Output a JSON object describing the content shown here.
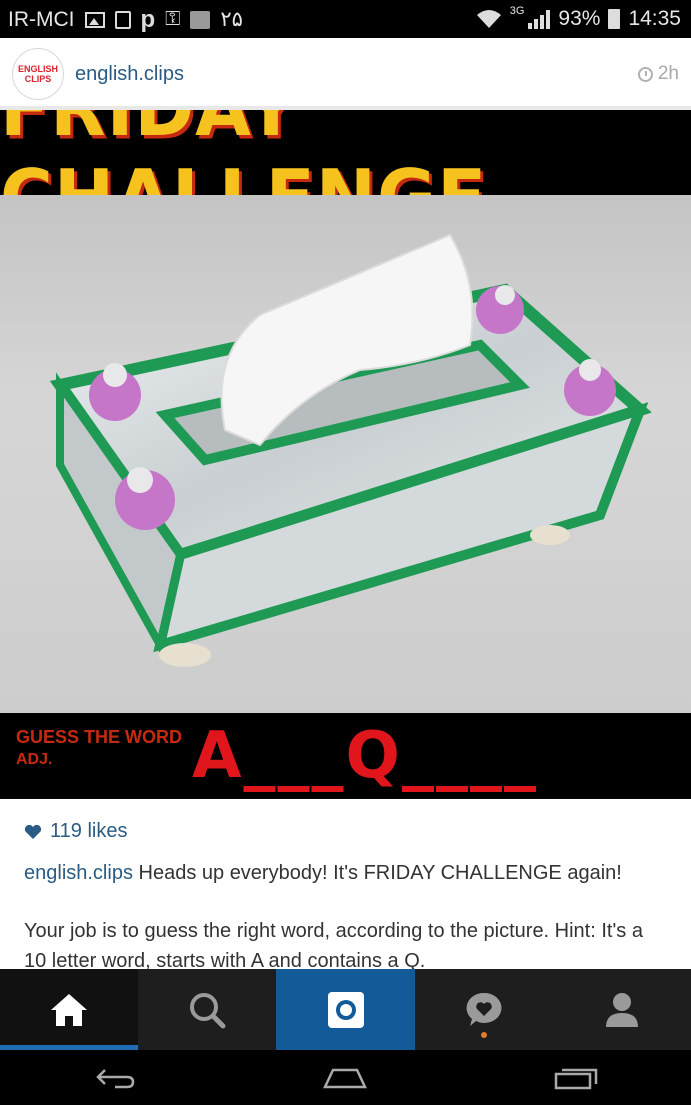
{
  "status_bar": {
    "carrier": "IR-MCI",
    "notification_number": "۲۵",
    "network": "3G",
    "battery": "93%",
    "time": "14:35"
  },
  "post": {
    "username": "english.clips",
    "avatar_text_line1": "ENGLISH",
    "avatar_text_line2": "CLIPS",
    "time_ago": "2h",
    "image": {
      "banner_title": "FRIDAY CHALLENGE",
      "hint_line1": "GUESS THE WORD",
      "hint_line2": "ADJ.",
      "word_pattern": "A___Q____"
    },
    "likes": "119 likes",
    "caption_user": "english.clips",
    "caption_text": "Heads up everybody! It's FRIDAY CHALLENGE again!",
    "caption_paragraph2": "Your job is to guess the right word, according to the picture. Hint: It's a 10 letter word, starts with A and contains a Q."
  },
  "bottom_nav": {
    "items": [
      {
        "name": "home",
        "icon": "home-icon",
        "active": true
      },
      {
        "name": "search",
        "icon": "search-icon",
        "active": false
      },
      {
        "name": "camera",
        "icon": "camera-icon",
        "active": false
      },
      {
        "name": "activity",
        "icon": "heart-bubble-icon",
        "active": false,
        "notification_dot": true
      },
      {
        "name": "profile",
        "icon": "person-icon",
        "active": false
      }
    ]
  },
  "colors": {
    "accent_blue": "#2a5b84",
    "nav_active_underline": "#1f6db5",
    "camera_tab_bg": "#135a98",
    "banner_yellow": "#f6c21e",
    "banner_red": "#e0161c",
    "notification_dot": "#e27b2a"
  }
}
